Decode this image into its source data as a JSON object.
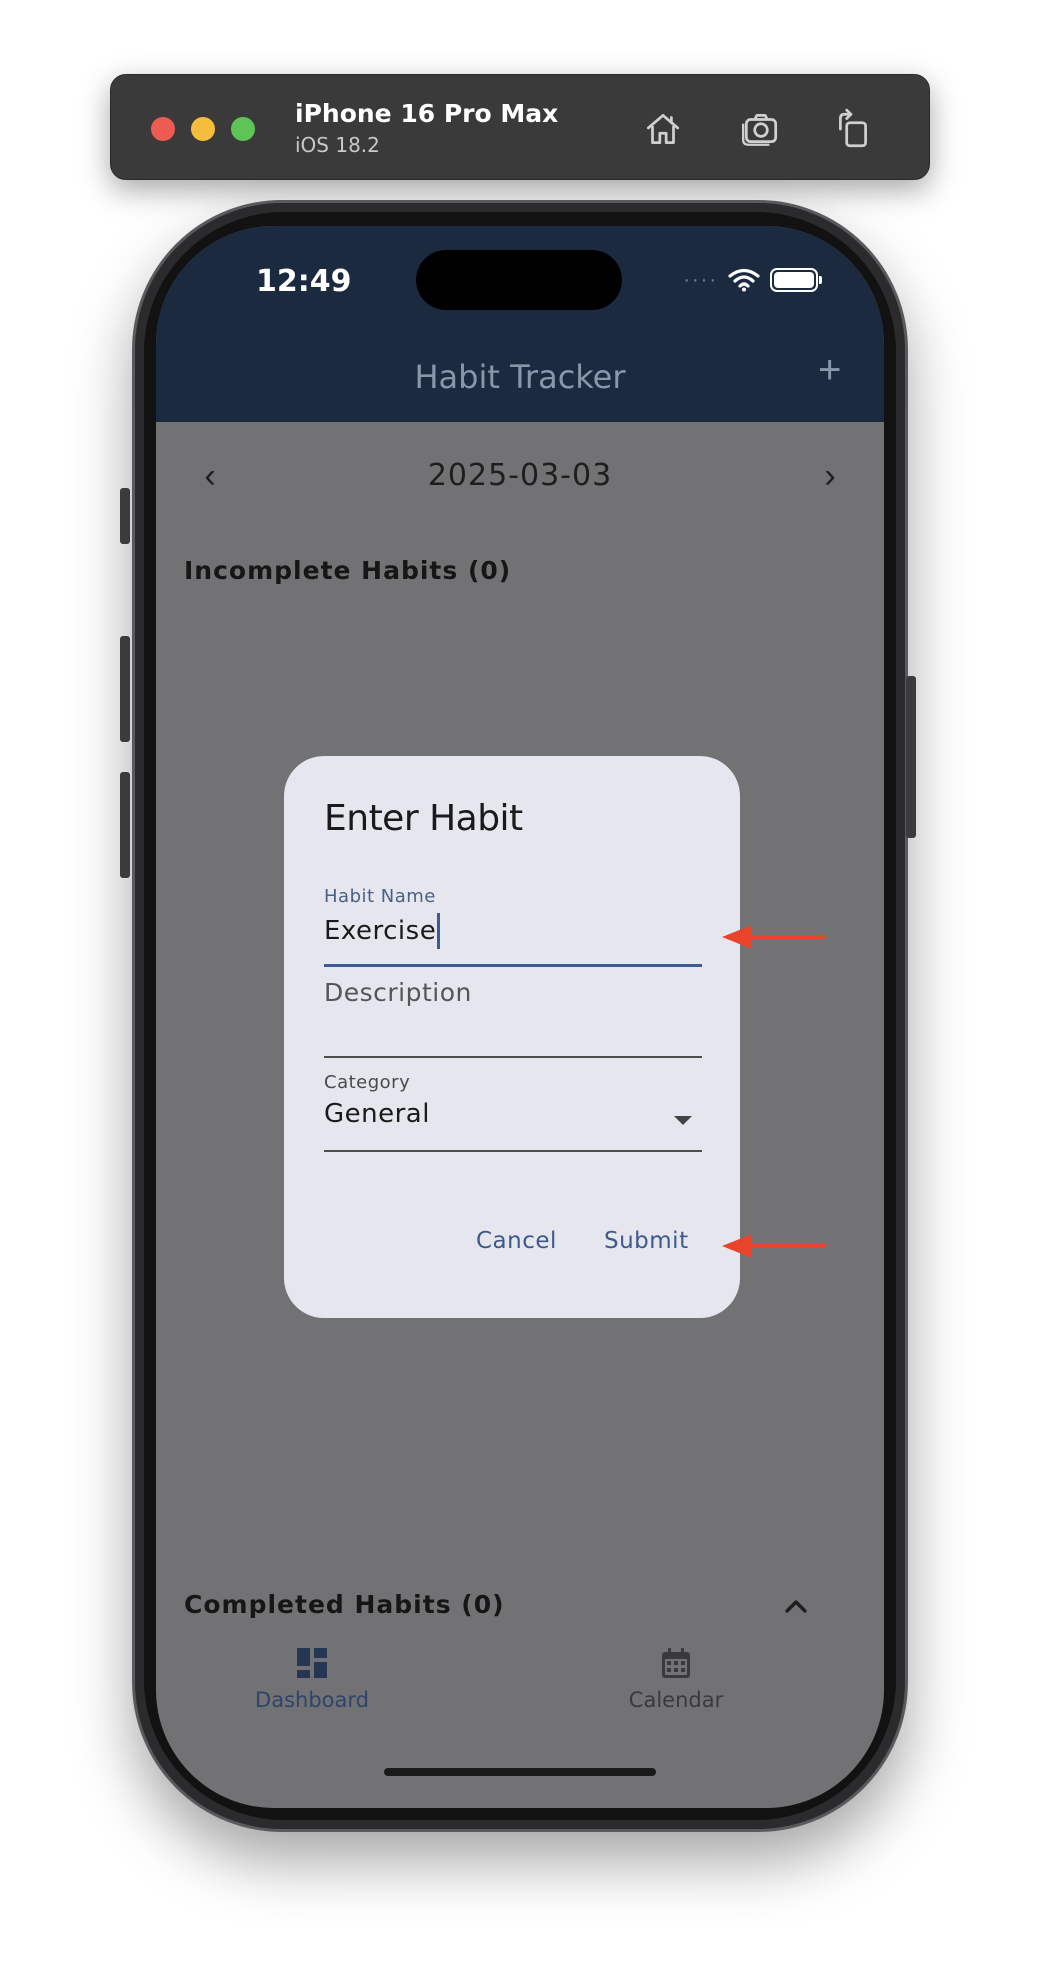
{
  "simulator": {
    "device_name": "iPhone 16 Pro Max",
    "os_version": "iOS 18.2",
    "buttons": [
      "home-icon",
      "screenshot-icon",
      "rotate-icon"
    ]
  },
  "status_bar": {
    "time": "12:49",
    "signal": "····",
    "icons": [
      "wifi-icon",
      "battery-icon"
    ]
  },
  "app_bar": {
    "title": "Habit Tracker",
    "add_label": "+"
  },
  "date_nav": {
    "prev": "‹",
    "date": "2025-03-03",
    "next": "›"
  },
  "sections": {
    "incomplete": "Incomplete Habits (0)",
    "completed": "Completed Habits (0)"
  },
  "bottom_nav": {
    "items": [
      {
        "label": "Dashboard",
        "icon": "dashboard-icon",
        "active": true
      },
      {
        "label": "Calendar",
        "icon": "calendar-icon",
        "active": false
      }
    ]
  },
  "dialog": {
    "title": "Enter Habit",
    "habit_name": {
      "label": "Habit Name",
      "value": "Exercise"
    },
    "description": {
      "placeholder": "Description"
    },
    "category": {
      "label": "Category",
      "value": "General"
    },
    "cancel_label": "Cancel",
    "submit_label": "Submit"
  },
  "colors": {
    "header_bg": "#1c2a40",
    "overlay": "#727274",
    "dialog_bg": "#e6e7ee",
    "accent": "#3d5a8a",
    "annotation_arrow": "#e8432b"
  }
}
